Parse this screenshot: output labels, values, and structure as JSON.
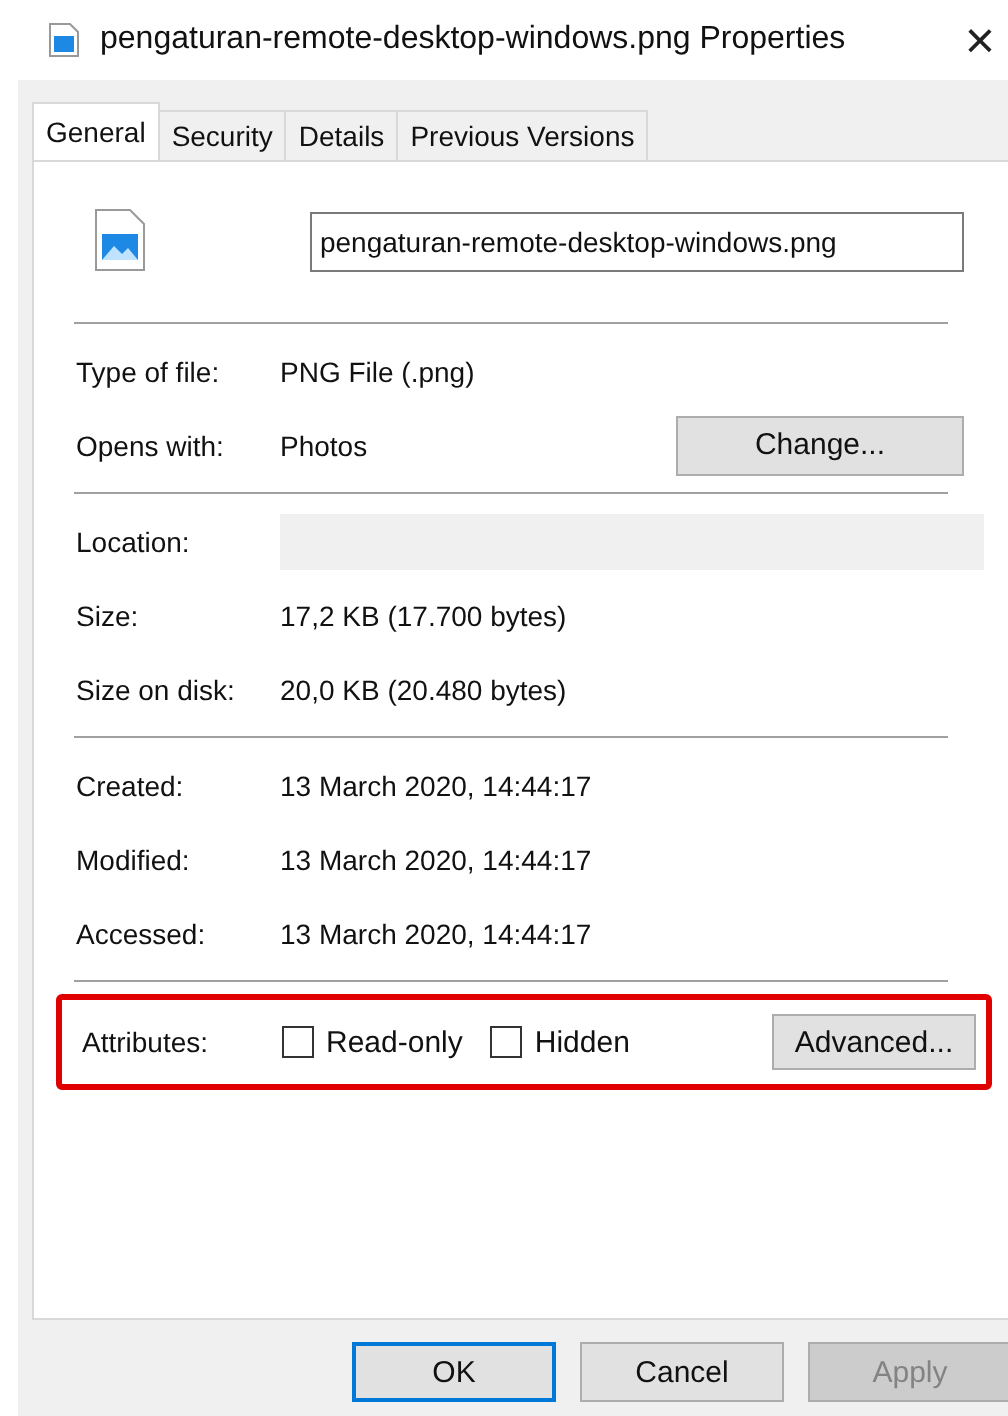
{
  "window": {
    "title": "pengaturan-remote-desktop-windows.png Properties",
    "close": "×"
  },
  "tabs": [
    {
      "label": "General",
      "selected": true
    },
    {
      "label": "Security",
      "selected": false
    },
    {
      "label": "Details",
      "selected": false
    },
    {
      "label": "Previous Versions",
      "selected": false
    }
  ],
  "file_name": "pengaturan-remote-desktop-windows.png",
  "sections": [
    {
      "rows": [
        {
          "label": "Type of file:",
          "value": "PNG File (.png)"
        },
        {
          "label": "Opens with:",
          "value": "Photos",
          "button": "Change..."
        }
      ]
    },
    {
      "rows": [
        {
          "label": "Location:",
          "kind": "field"
        },
        {
          "label": "Size:",
          "value": "17,2 KB (17.700 bytes)"
        },
        {
          "label": "Size on disk:",
          "value": "20,0 KB (20.480 bytes)"
        }
      ]
    },
    {
      "rows": [
        {
          "label": "Created:",
          "value": "13 March 2020, 14:44:17"
        },
        {
          "label": "Modified:",
          "value": "13 March 2020, 14:44:17"
        },
        {
          "label": "Accessed:",
          "value": "13 March 2020, 14:44:17"
        }
      ]
    }
  ],
  "attributes": {
    "label": "Attributes:",
    "highlighted": true,
    "options": [
      {
        "label": "Read-only",
        "checked": false
      },
      {
        "label": "Hidden",
        "checked": false
      }
    ],
    "button": "Advanced..."
  },
  "buttons": [
    {
      "label": "OK",
      "default": true,
      "disabled": false
    },
    {
      "label": "Cancel",
      "default": false,
      "disabled": false
    },
    {
      "label": "Apply",
      "default": false,
      "disabled": true
    }
  ]
}
